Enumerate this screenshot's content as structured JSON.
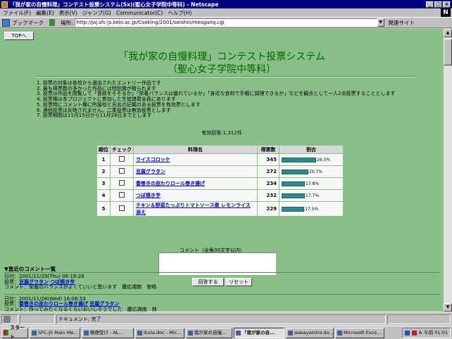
{
  "window": {
    "title": "「我が家の自慢料理」コンテスト投票システム(Sx)(聖心女子学院中等科) - Netscape"
  },
  "menu": [
    "ファイル(F)",
    "編集(E)",
    "表示(V)",
    "ジャンプ(G)",
    "Communicator(C)",
    "ヘルプ(H)"
  ],
  "location": {
    "bookmarks_label": "ブックマーク",
    "location_label": "場所:",
    "url": "http://jaj.sfc-js.keio.ac.jp/Cooking/2001/seishin/mesganq.cgi",
    "related_label": "関連サイト"
  },
  "page": {
    "top_button": "TOPへ",
    "title_line1": "「我が家の自慢料理」コンテスト投票システム",
    "title_line2": "（聖心女子学院中等科）",
    "rules": [
      "1.  投票の対象は各校から選出されたエントリー作品です",
      "2.  最も得票数の多かった作品には特別賞が贈られます",
      "3.  投票は作品を閲覧して「食欲をそそるか」「栄養バランスは優れているか」「身近な食材で手軽に調理できるか」などを観点として一人2点投票することとします",
      "4.  投票権は本プロジェクトに参加した生徒諸君全員にあります",
      "5.  投票時にコメント欄に所属校と氏名の記載のある投票を有効票とします",
      "6.  連続投票は反映されません。二重投票は無効投票とします",
      "7.  投票期間は11月15日から11月28日までとします"
    ],
    "valid_votes": "有効回答:1,312件",
    "table_headers": [
      "順位",
      "チェック",
      "料理名",
      "得票数",
      "割合"
    ],
    "results": [
      {
        "rank": "1",
        "name": "ライスコロッケ",
        "votes": "345",
        "percent_label": "26.3%",
        "percent": 26.3
      },
      {
        "rank": "2",
        "name": "豆腐グラタン",
        "votes": "272",
        "percent_label": "20.7%",
        "percent": 20.7
      },
      {
        "rank": "3",
        "name": "春巻きの皮わりロール巻き揚げ",
        "votes": "234",
        "percent_label": "17.8%",
        "percent": 17.8
      },
      {
        "rank": "4",
        "name": "つぼ焼き芋",
        "votes": "232",
        "percent_label": "17.7%",
        "percent": 17.7
      },
      {
        "rank": "5",
        "name": "チキン＆野菜たっぷりトマトソース煮 レモンライス添え",
        "votes": "229",
        "percent_label": "17.5%",
        "percent": 17.5
      }
    ],
    "comment_label": "コメント（全角30文字以内）",
    "submit_label": "回答する",
    "reset_label": "リセット",
    "recent_heading": "▼直近のコメント一覧",
    "recent": [
      {
        "date": "日付：2001/11/29(Thu) 08:19:28",
        "vote_label": "投票：",
        "votes": [
          "豆腐グラタン",
          "つぼ焼き芋"
        ],
        "comment": "コメント：栄養のバランスがよくていいと思います　慶応湘南　宮嶋"
      },
      {
        "date": "日付：2001/11/28(Wed) 16:08:53",
        "vote_label": "投票：",
        "votes": [
          "春巻きの皮わりロール巻き揚げ",
          "豆腐グラタン"
        ],
        "comment": "コメント：作ってみたくなるくらいおいしそうでした　慶応湘南　林"
      }
    ]
  },
  "status": {
    "text": "ドキュメント: 完了"
  },
  "taskbar": {
    "start": "スタート",
    "tasks": [
      "SFC-JS Main Me...",
      "郵便受け - AL...",
      "ikuta.doc - Mic...",
      "我が家の自慢...",
      "「我が家の自...",
      "wasayaintro.do...",
      "Microsoft Exce..."
    ],
    "active_index": 4,
    "clock": "午前 01:01",
    "ime": "A"
  },
  "colors": {
    "page_bg": "#88c088",
    "title_green": "#006400",
    "bar": "#2e8b8b",
    "link": "#0000cc"
  }
}
